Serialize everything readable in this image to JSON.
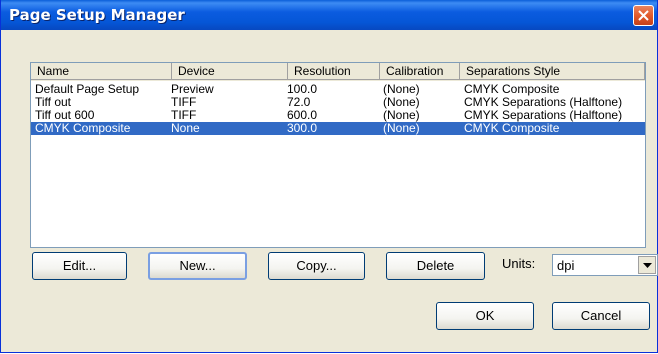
{
  "window": {
    "title": "Page Setup Manager",
    "close_icon": "close-icon"
  },
  "list": {
    "columns": [
      "Name",
      "Device",
      "Resolution",
      "Calibration",
      "Separations Style"
    ],
    "rows": [
      [
        "Default Page Setup",
        "Preview",
        "100.0",
        "(None)",
        "CMYK Composite"
      ],
      [
        "Tiff out",
        "TIFF",
        "72.0",
        "(None)",
        "CMYK Separations (Halftone)"
      ],
      [
        "Tiff out 600",
        "TIFF",
        "600.0",
        "(None)",
        "CMYK Separations (Halftone)"
      ],
      [
        "CMYK Composite",
        "None",
        "300.0",
        "(None)",
        "CMYK Composite"
      ]
    ],
    "selected_row": 3
  },
  "buttons": {
    "edit": "Edit...",
    "new": "New...",
    "copy": "Copy...",
    "delete": "Delete",
    "ok": "OK",
    "cancel": "Cancel"
  },
  "units": {
    "label": "Units:",
    "value": "dpi"
  },
  "colors": {
    "titlebar": "#0556d6",
    "selection": "#316ac5",
    "close_button": "#e35b2c",
    "window_background": "#ece9d8"
  }
}
